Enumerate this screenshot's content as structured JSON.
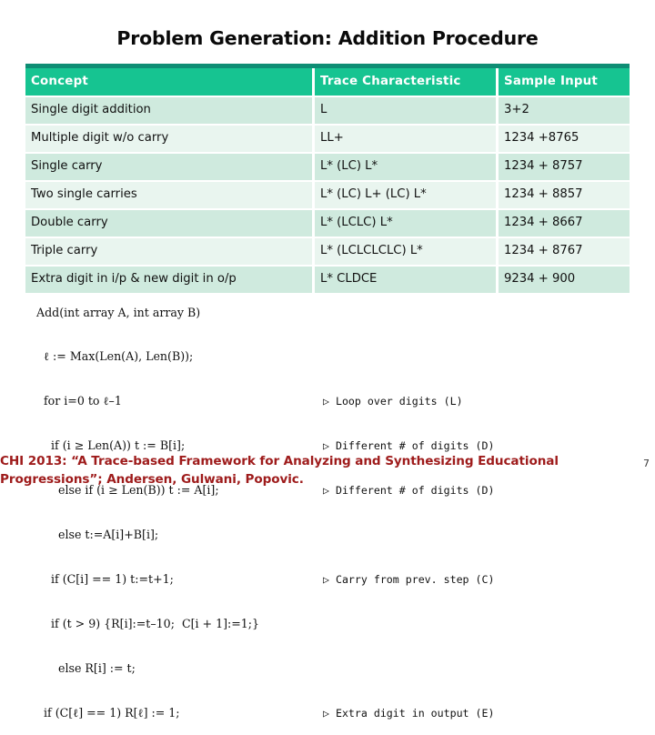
{
  "slide": {
    "title": "Problem Generation: Addition Procedure",
    "page_number": "7",
    "accent_dark": "#0e8d74",
    "accent_green": "#16c491",
    "row_odd": "#cfeade",
    "row_even": "#e9f5ef",
    "footer_color": "#9e1b1b"
  },
  "table": {
    "headers": [
      "Concept",
      "Trace Characteristic",
      "Sample Input"
    ],
    "rows": [
      {
        "concept": "Single digit addition",
        "trace": "L",
        "sample": "3+2"
      },
      {
        "concept": "Multiple digit w/o carry",
        "trace": "LL+",
        "sample": "1234 +8765"
      },
      {
        "concept": "Single carry",
        "trace": "L* (LC) L*",
        "sample": "1234 + 8757"
      },
      {
        "concept": "Two single carries",
        "trace": "L* (LC) L+ (LC) L*",
        "sample": "1234 + 8857"
      },
      {
        "concept": "Double carry",
        "trace": "L* (LCLC) L*",
        "sample": "1234 + 8667"
      },
      {
        "concept": "Triple carry",
        "trace": "L* (LCLCLCLC) L*",
        "sample": "1234 + 8767"
      },
      {
        "concept": "Extra digit in i/p & new digit in o/p",
        "trace": "L* CLDCE",
        "sample": "9234 + 900"
      }
    ]
  },
  "pseudocode": {
    "lines": [
      {
        "code": "Add(int array A, int array B)",
        "comment": ""
      },
      {
        "code": "  ℓ := Max(Len(A), Len(B));",
        "comment": ""
      },
      {
        "code": "  for i=0 to ℓ–1",
        "comment": "▷ Loop over digits (L)"
      },
      {
        "code": "    if (i ≥ Len(A)) t := B[i];",
        "comment": "▷ Different # of digits (D)"
      },
      {
        "code": "      else if (i ≥ Len(B)) t := A[i];",
        "comment": "▷ Different # of digits (D)"
      },
      {
        "code": "      else t:=A[i]+B[i];",
        "comment": ""
      },
      {
        "code": "    if (C[i] == 1) t:=t+1;",
        "comment": "▷ Carry from prev. step (C)"
      },
      {
        "code": "    if (t > 9) {R[i]:=t–10;  C[i + 1]:=1;}",
        "comment": ""
      },
      {
        "code": "      else R[i] := t;",
        "comment": ""
      },
      {
        "code": "  if (C[ℓ] == 1) R[ℓ] := 1;",
        "comment": "▷ Extra digit in output (E)"
      }
    ]
  },
  "footer": {
    "line1": "CHI 2013: “A Trace-based Framework for Analyzing and Synthesizing Educational",
    "line2": "Progressions”; Andersen, Gulwani, Popovic."
  }
}
